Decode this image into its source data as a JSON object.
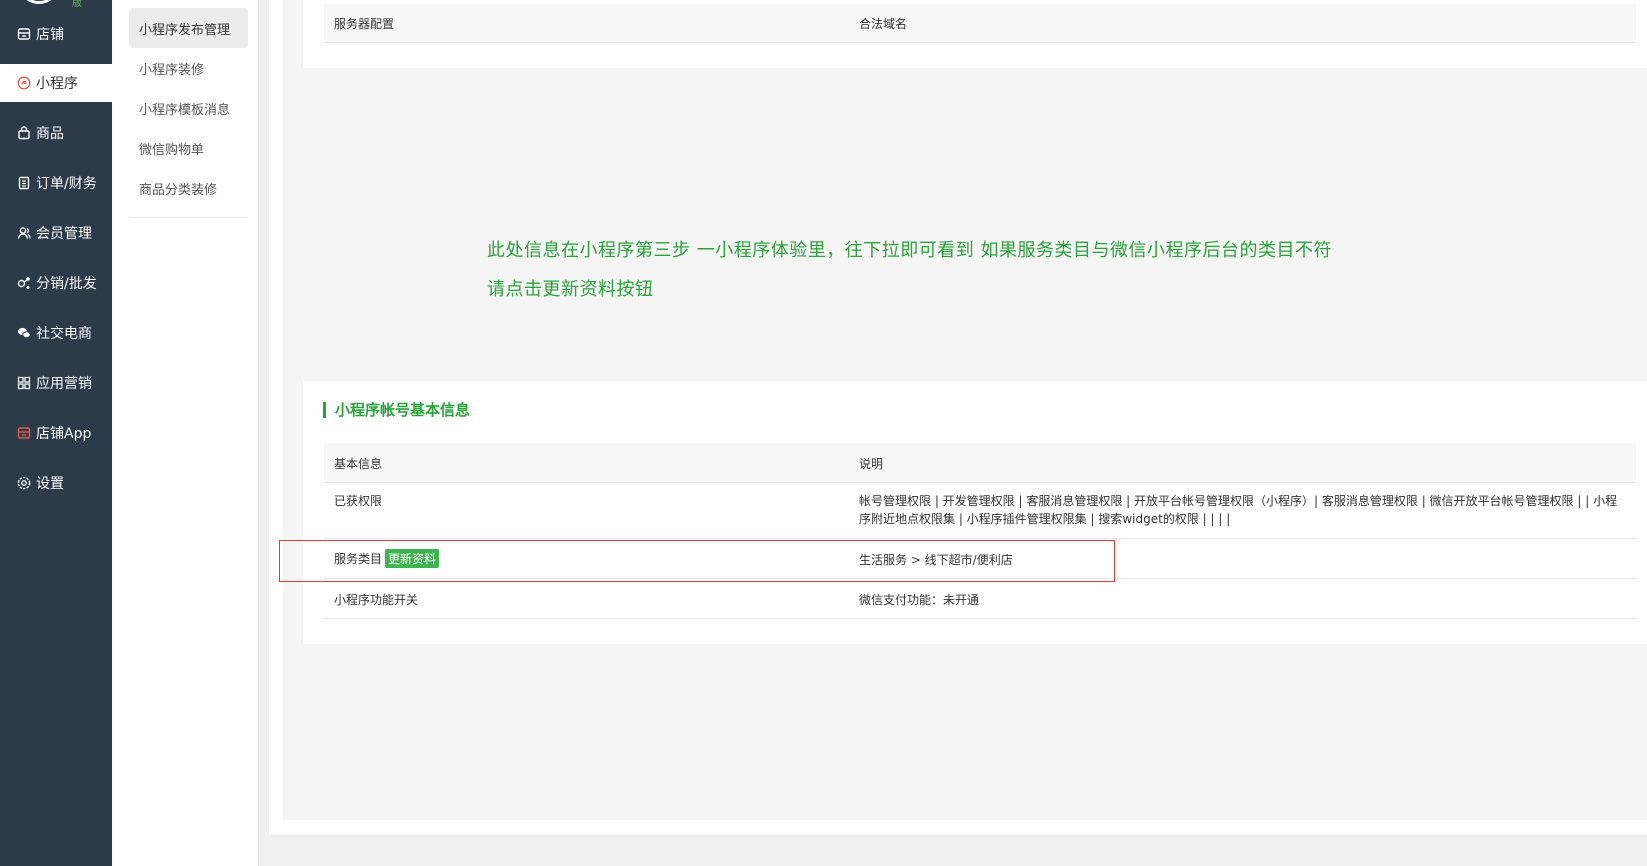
{
  "sidebar": {
    "logo_tag": "版",
    "items": [
      {
        "label": "店铺",
        "icon": "store-icon"
      },
      {
        "label": "小程序",
        "icon": "miniprogram-icon"
      },
      {
        "label": "商品",
        "icon": "bag-icon"
      },
      {
        "label": "订单/财务",
        "icon": "clipboard-icon"
      },
      {
        "label": "会员管理",
        "icon": "members-icon"
      },
      {
        "label": "分销/批发",
        "icon": "share-icon"
      },
      {
        "label": "社交电商",
        "icon": "chat-icon"
      },
      {
        "label": "应用营销",
        "icon": "apps-icon"
      },
      {
        "label": "店铺App",
        "icon": "app-store-icon"
      },
      {
        "label": "设置",
        "icon": "gear-icon"
      }
    ],
    "active_index": 1
  },
  "submenu": {
    "items": [
      "小程序发布管理",
      "小程序装修",
      "小程序模板消息",
      "微信购物单",
      "商品分类装修"
    ],
    "active_index": 0
  },
  "server_config": {
    "col_a": "服务器配置",
    "col_b": "合法域名"
  },
  "note": {
    "line1": "此处信息在小程序第三步 一小程序体验里，往下拉即可看到 如果服务类目与微信小程序后台的类目不符",
    "line2": "请点击更新资料按钮"
  },
  "account_info": {
    "title": "小程序帐号基本信息",
    "header": {
      "col_a": "基本信息",
      "col_b": "说明"
    },
    "rows": [
      {
        "label": "已获权限",
        "value": "帐号管理权限 | 开发管理权限 | 客服消息管理权限 | 开放平台帐号管理权限（小程序）| 客服消息管理权限 | 微信开放平台帐号管理权限 | | 小程序附近地点权限集 | 小程序插件管理权限集 | 搜索widget的权限 | | | |"
      },
      {
        "label": "服务类目",
        "button": "更新资料",
        "value": "生活服务 > 线下超市/便利店"
      },
      {
        "label": "小程序功能开关",
        "value": "微信支付功能：未开通"
      }
    ]
  },
  "colors": {
    "sidebar_bg": "#2c3a4a",
    "accent_green": "#2aa33a",
    "highlight_red": "#e23b3b"
  }
}
